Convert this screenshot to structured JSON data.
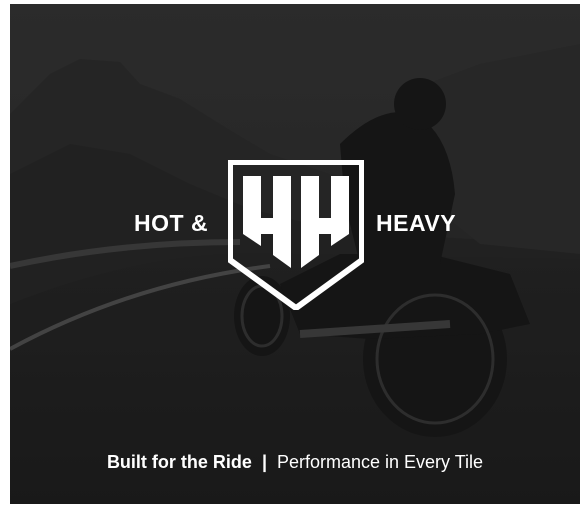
{
  "brand": {
    "left_word": "HOT &",
    "right_word": "HEAVY"
  },
  "tagline": {
    "primary": "Built for the Ride",
    "separator": "|",
    "secondary": "Performance in Every Tile"
  },
  "colors": {
    "text": "#ffffff",
    "overlay": "#2f2f2f"
  }
}
